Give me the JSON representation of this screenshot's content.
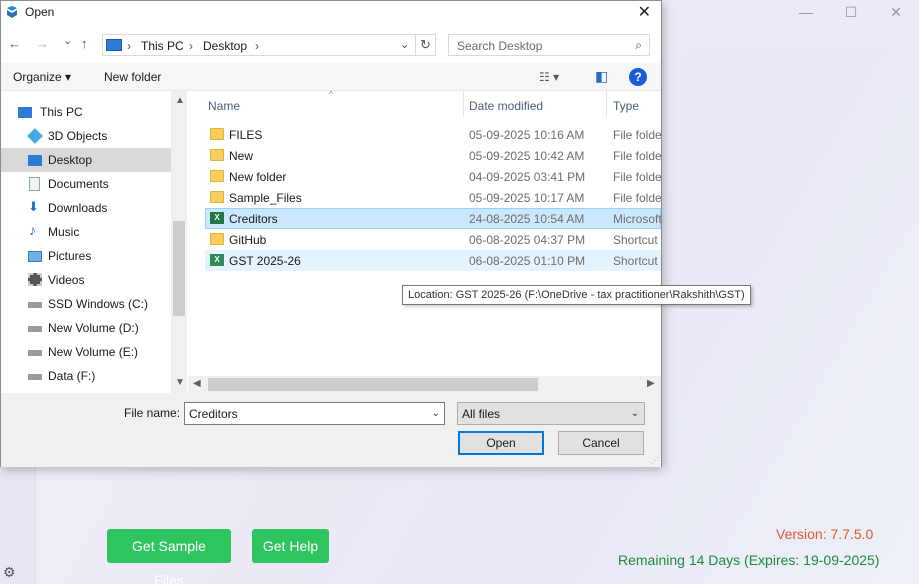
{
  "app": {
    "version": "Version: 7.7.5.0",
    "remaining": "Remaining 14 Days (Expires: 19-09-2025)",
    "buttons": {
      "sample": "Get Sample Files",
      "help": "Get Help"
    },
    "window_controls": {
      "minimize": "—",
      "maximize": "☐",
      "close": "✕"
    }
  },
  "dialog": {
    "title": "Open",
    "nav": {
      "back": "←",
      "forward": "→",
      "recent": "⌄",
      "up": "↑"
    },
    "breadcrumb": [
      "This PC",
      "Desktop"
    ],
    "search_placeholder": "Search Desktop",
    "toolbar": {
      "organize": "Organize ▾",
      "new_folder": "New folder"
    },
    "sidebar": [
      {
        "label": "This PC",
        "icon": "pc-icon"
      },
      {
        "label": "3D Objects",
        "icon": "cube-icon"
      },
      {
        "label": "Desktop",
        "icon": "desktop-icon",
        "selected": true
      },
      {
        "label": "Documents",
        "icon": "document-icon"
      },
      {
        "label": "Downloads",
        "icon": "download-icon"
      },
      {
        "label": "Music",
        "icon": "music-icon"
      },
      {
        "label": "Pictures",
        "icon": "picture-icon"
      },
      {
        "label": "Videos",
        "icon": "video-icon"
      },
      {
        "label": "SSD Windows (C:)",
        "icon": "drive-icon"
      },
      {
        "label": "New Volume (D:)",
        "icon": "drive-icon"
      },
      {
        "label": "New Volume (E:)",
        "icon": "drive-icon"
      },
      {
        "label": "Data (F:)",
        "icon": "drive-icon"
      }
    ],
    "columns": {
      "name": "Name",
      "date": "Date modified",
      "type": "Type"
    },
    "files": [
      {
        "name": "FILES",
        "date": "05-09-2025 10:16 AM",
        "type": "File folder",
        "icon": "folder-icon"
      },
      {
        "name": "New",
        "date": "05-09-2025 10:42 AM",
        "type": "File folder",
        "icon": "folder-icon"
      },
      {
        "name": "New folder",
        "date": "04-09-2025 03:41 PM",
        "type": "File folder",
        "icon": "folder-icon"
      },
      {
        "name": "Sample_Files",
        "date": "05-09-2025 10:17 AM",
        "type": "File folder",
        "icon": "folder-icon"
      },
      {
        "name": "Creditors",
        "date": "24-08-2025 10:54 AM",
        "type": "Microsoft",
        "icon": "excel-icon",
        "selected": true
      },
      {
        "name": "GitHub",
        "date": "06-08-2025 04:37 PM",
        "type": "Shortcut",
        "icon": "shortcut-icon"
      },
      {
        "name": "GST 2025-26",
        "date": "06-08-2025 01:10 PM",
        "type": "Shortcut",
        "icon": "shortcut-icon",
        "hover": true
      }
    ],
    "tooltip": "Location: GST 2025-26 (F:\\OneDrive - tax practitioner\\Rakshith\\GST)",
    "file_name_label": "File name:",
    "file_name_value": "Creditors",
    "file_type": "All files",
    "open_label": "Open",
    "cancel_label": "Cancel"
  }
}
